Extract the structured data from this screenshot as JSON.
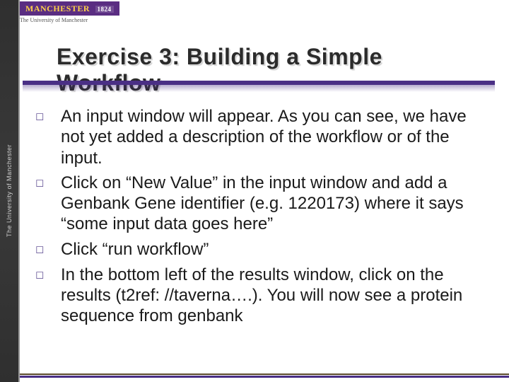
{
  "brand": {
    "name": "MANCHESTER",
    "year": "1824",
    "subtitle": "The University of Manchester"
  },
  "sidebar": {
    "text": "The University of Manchester"
  },
  "title": "Exercise 3: Building a Simple Workflow",
  "bullets": [
    "An input window will appear. As you can see, we have not yet added a description of the workflow or of the input.",
    "Click on “New Value” in the input window and add a Genbank Gene identifier (e.g. 1220173) where it says “some input data goes here”",
    "Click “run workflow”",
    "In the bottom left of the results window, click on the results (t2ref: //taverna….). You will now see a protein sequence from genbank"
  ]
}
